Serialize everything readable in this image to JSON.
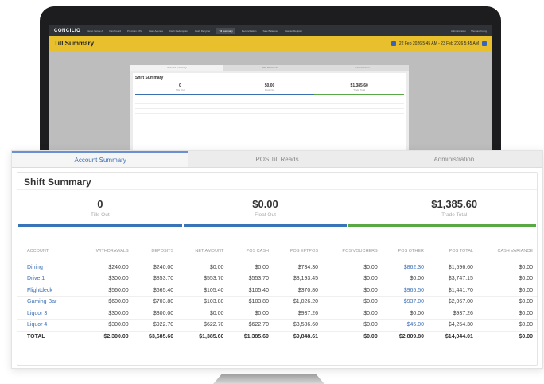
{
  "background_app": {
    "logo": "CONCILIO",
    "nav": [
      "Demo Venue A",
      "Dashboard",
      "Premium ATM",
      "Cash Agenda",
      "Cash Redemption",
      "Cash Recycler",
      "Till Summary",
      "Reconciliation",
      "Safe Balances",
      "Cashier Register"
    ],
    "nav_right": [
      "Administration",
      "Thomas Young"
    ],
    "page_title": "Till Summary",
    "date_range": "22 Feb 2026 5:45 AM - 23 Feb 2026 5:45 AM"
  },
  "tabs": [
    "Account Summary",
    "POS Till Reads",
    "Administration"
  ],
  "card_title": "Shift Summary",
  "stats": [
    {
      "value": "0",
      "label": "Tills Out"
    },
    {
      "value": "$0.00",
      "label": "Float Out"
    },
    {
      "value": "$1,385.60",
      "label": "Trade Total"
    }
  ],
  "table": {
    "headers": [
      "ACCOUNT",
      "WITHDRAWALS",
      "DEPOSITS",
      "NET AMOUNT",
      "POS CASH",
      "POS EFTPOS",
      "POS VOUCHERS",
      "POS OTHER",
      "POS TOTAL",
      "CASH VARIANCE"
    ],
    "rows": [
      [
        "Dining",
        "$240.00",
        "$240.00",
        "$0.00",
        "$0.00",
        "$734.30",
        "$0.00",
        "$862.30",
        "$1,596.60",
        "$0.00"
      ],
      [
        "Drive 1",
        "$300.00",
        "$853.70",
        "$553.70",
        "$553.70",
        "$3,193.45",
        "$0.00",
        "$0.00",
        "$3,747.15",
        "$0.00"
      ],
      [
        "Flightdeck",
        "$560.00",
        "$665.40",
        "$105.40",
        "$105.40",
        "$370.80",
        "$0.00",
        "$965.50",
        "$1,441.70",
        "$0.00"
      ],
      [
        "Gaming Bar",
        "$600.00",
        "$703.80",
        "$103.80",
        "$103.80",
        "$1,026.20",
        "$0.00",
        "$937.00",
        "$2,067.00",
        "$0.00"
      ],
      [
        "Liquor 3",
        "$300.00",
        "$300.00",
        "$0.00",
        "$0.00",
        "$937.26",
        "$0.00",
        "$0.00",
        "$937.26",
        "$0.00"
      ],
      [
        "Liquor 4",
        "$300.00",
        "$922.70",
        "$622.70",
        "$622.70",
        "$3,586.60",
        "$0.00",
        "$45.00",
        "$4,254.30",
        "$0.00"
      ]
    ],
    "total": [
      "TOTAL",
      "$2,300.00",
      "$3,685.60",
      "$1,385.60",
      "$1,385.60",
      "$9,848.61",
      "$0.00",
      "$2,809.80",
      "$14,044.01",
      "$0.00"
    ]
  },
  "colors": {
    "accent_blue": "#3b6fb5",
    "trade_green": "#5aa844",
    "header_yellow": "#e8c02e"
  }
}
